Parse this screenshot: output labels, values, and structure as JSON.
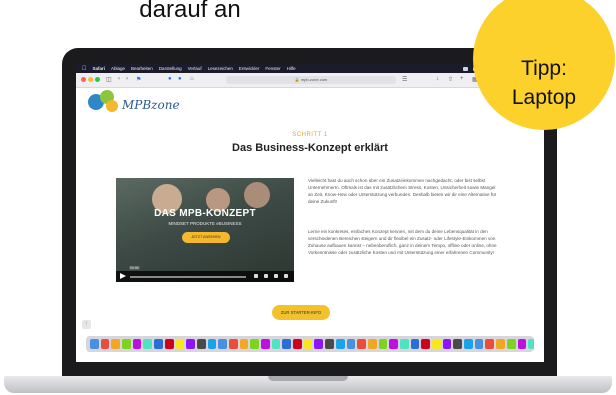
{
  "caption": "darauf an",
  "badge": {
    "line1": "Tipp:",
    "line2": "Laptop",
    "color": "#fcd12b"
  },
  "menubar": {
    "app": "Safari",
    "items": [
      "Ablage",
      "Bearbeiten",
      "Darstellung",
      "Verlauf",
      "Lesezeichen",
      "Entwickler",
      "Fenster",
      "Hilfe"
    ]
  },
  "browser": {
    "url": "mpb-zone.com"
  },
  "site": {
    "logo": "MPBzone",
    "step_label": "SCHRITT 1",
    "headline": "Das Business-Konzept erklärt",
    "video": {
      "title": "DAS MPB-KONZEPT",
      "subtitle": "MINDSET PRODUKTE eBUSINESS",
      "button": "JETZT ANSEHEN",
      "time": "00:00"
    },
    "paragraph1": "Vielleicht hast du auch schon über ein Zusatzeinkommen nachgedacht, oder bist selbst UnternehmerIn. Oftmals ist das mit zusätzlichem Stress, Kosten, Unsicherheit sowie Mangel an Zeit, Know-How oder Unterstützung verbunden. Deshalb bieten wir dir eine Alternative für deine Zukunft!",
    "paragraph2": "Lerne ein konkretes, einfaches Konzept kennen, mit dem du deine Lebensqualität in den verschiedenen Bereichen steigern und dir flexibel ein Zusatz- oder Lifestyle-Einkommen von Zuhause aufbauen kannst – nebenberuflich, ganz in deinem Tempo, offline oder online, ohne Vorkenntnisse oder zusätzliche Kosten und mit Unterstützung einer erfahrenen Community!",
    "cta": "ZUR STARTER-INFO",
    "accent": "#f3c12c"
  },
  "dock_icons": [
    "finder-icon",
    "launchpad-icon",
    "safari-icon",
    "chrome-icon",
    "mail-icon",
    "calendar-icon",
    "notes-icon",
    "reminders-icon",
    "photos-icon",
    "messages-icon",
    "facetime-icon",
    "music-icon",
    "podcasts-icon",
    "tv-icon",
    "appstore-icon",
    "settings-icon",
    "word-icon",
    "excel-icon",
    "powerpoint-icon",
    "acrobat-icon",
    "photoshop-icon",
    "lightroom-icon",
    "zoom-icon",
    "skype-icon",
    "spotify-icon",
    "whatsapp-icon",
    "telegram-icon",
    "slack-icon",
    "dropbox-icon",
    "drive-icon",
    "preview-icon",
    "textedit-icon",
    "terminal-icon",
    "calculator-icon",
    "maps-icon",
    "books-icon",
    "news-icon",
    "stocks-icon",
    "home-icon",
    "folder-icon",
    "downloads-icon",
    "trash-icon"
  ]
}
